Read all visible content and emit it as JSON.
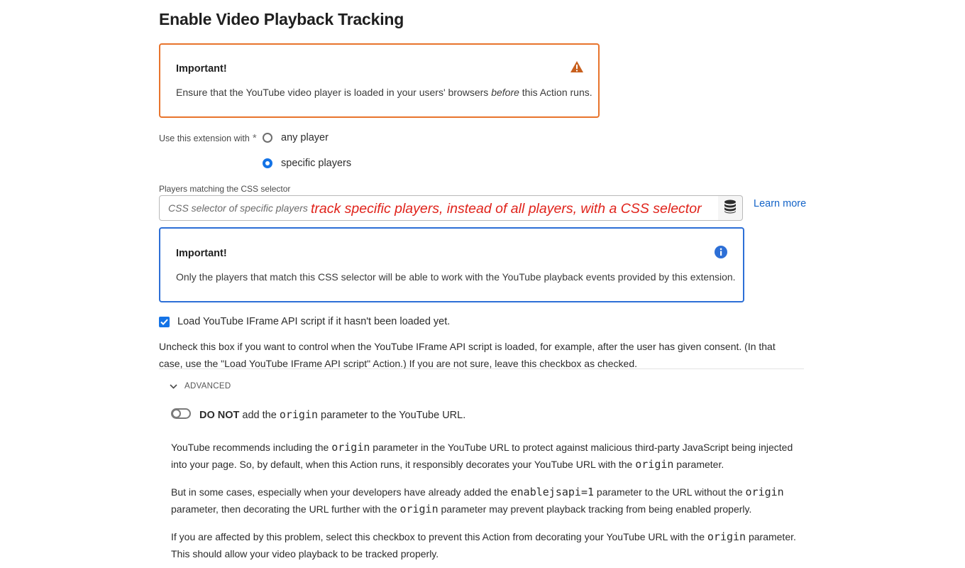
{
  "page": {
    "title": "Enable Video Playback Tracking"
  },
  "warning_alert": {
    "heading": "Important!",
    "body_before": "Ensure that the YouTube video player is loaded in your users' browsers ",
    "body_emphasis": "before",
    "body_after": " this Action runs.",
    "icon": "warning-icon",
    "color": "#e8742c"
  },
  "player_scope": {
    "label": "Use this extension with",
    "required_marker": "*",
    "options": [
      {
        "label": "any player",
        "selected": false
      },
      {
        "label": "specific players",
        "selected": true
      }
    ]
  },
  "css_selector": {
    "label": "Players matching the CSS selector",
    "placeholder": "CSS selector of specific players",
    "value": "",
    "data_element_icon": "database-icon",
    "annotation": "track specific players, instead of all players, with a CSS selector",
    "learn_more": "Learn more"
  },
  "info_alert": {
    "heading": "Important!",
    "body": "Only the players that match this CSS selector will be able to work with the YouTube playback events provided by this extension.",
    "icon": "info-icon",
    "color": "#2d6fd6"
  },
  "load_api": {
    "checked": true,
    "label": "Load YouTube IFrame API script if it hasn't been loaded yet.",
    "help": "Uncheck this box if you want to control when the YouTube IFrame API script is loaded, for example, after the user has given consent. (In that case, use the \"Load YouTube IFrame API script\" Action.) If you are not sure, leave this checkbox as checked."
  },
  "advanced": {
    "label": "ADVANCED",
    "expanded": true,
    "origin_toggle": {
      "on": false,
      "label_bold": "DO NOT",
      "label_mid": " add the ",
      "label_code": "origin",
      "label_end": " parameter to the YouTube URL."
    },
    "para1": {
      "t1": "YouTube recommends including the ",
      "c1": "origin",
      "t2": " parameter in the YouTube URL to protect against malicious third-party JavaScript being injected into your page. So, by default, when this Action runs, it responsibly decorates your YouTube URL with the ",
      "c2": "origin",
      "t3": " parameter."
    },
    "para2": {
      "t1": "But in some cases, especially when your developers have already added the ",
      "c1": "enablejsapi=1",
      "t2": " parameter to the URL without the ",
      "c2": "origin",
      "t3": " parameter, then decorating the URL further with the ",
      "c3": "origin",
      "t4": " parameter may prevent playback tracking from being enabled properly."
    },
    "para3": {
      "t1": "If you are affected by this problem, select this checkbox to prevent this Action from decorating your YouTube URL with the ",
      "c1": "origin",
      "t2": " parameter. This should allow your video playback to be tracked properly."
    }
  },
  "colors": {
    "accent": "#1473e6",
    "link": "#1464c8",
    "annotation": "#e0231b"
  }
}
